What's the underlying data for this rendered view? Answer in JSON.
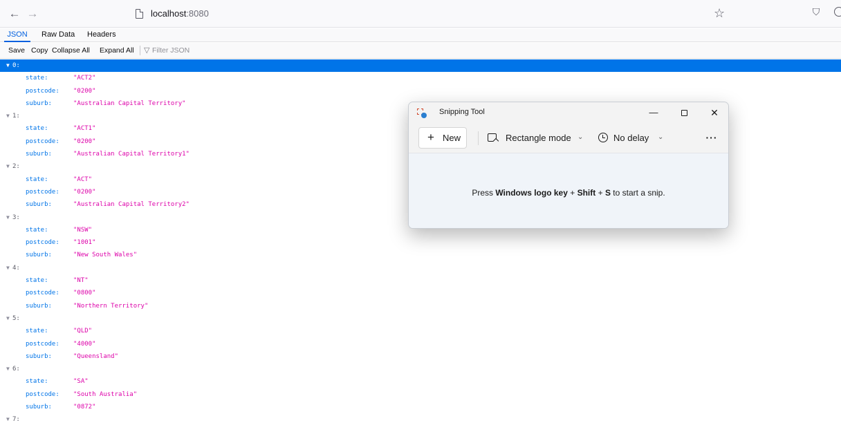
{
  "browser": {
    "back_icon": "←",
    "forward_icon": "→",
    "url_host": "localhost",
    "url_port": ":8080",
    "bookmark_icon": "☆",
    "pocket_icon": "⛉"
  },
  "viewer": {
    "tabs": [
      {
        "label": "JSON",
        "active": true
      },
      {
        "label": "Raw Data",
        "active": false
      },
      {
        "label": "Headers",
        "active": false
      }
    ],
    "toolbar": {
      "save": "Save",
      "copy": "Copy",
      "collapse_all": "Collapse All",
      "expand_all": "Expand All",
      "filter_placeholder": "Filter JSON"
    },
    "items": [
      {
        "index": "0:",
        "fields": [
          [
            "state:",
            "\"ACT2\""
          ],
          [
            "postcode:",
            "\"0200\""
          ],
          [
            "suburb:",
            "\"Australian Capital Territory\""
          ]
        ]
      },
      {
        "index": "1:",
        "fields": [
          [
            "state:",
            "\"ACT1\""
          ],
          [
            "postcode:",
            "\"0200\""
          ],
          [
            "suburb:",
            "\"Australian Capital Territory1\""
          ]
        ]
      },
      {
        "index": "2:",
        "fields": [
          [
            "state:",
            "\"ACT\""
          ],
          [
            "postcode:",
            "\"0200\""
          ],
          [
            "suburb:",
            "\"Australian Capital Territory2\""
          ]
        ]
      },
      {
        "index": "3:",
        "fields": [
          [
            "state:",
            "\"NSW\""
          ],
          [
            "postcode:",
            "\"1001\""
          ],
          [
            "suburb:",
            "\"New South Wales\""
          ]
        ]
      },
      {
        "index": "4:",
        "fields": [
          [
            "state:",
            "\"NT\""
          ],
          [
            "postcode:",
            "\"0800\""
          ],
          [
            "suburb:",
            "\"Northern Territory\""
          ]
        ]
      },
      {
        "index": "5:",
        "fields": [
          [
            "state:",
            "\"QLD\""
          ],
          [
            "postcode:",
            "\"4000\""
          ],
          [
            "suburb:",
            "\"Queensland\""
          ]
        ]
      },
      {
        "index": "6:",
        "fields": [
          [
            "state:",
            "\"SA\""
          ],
          [
            "postcode:",
            "\"South Australia\""
          ],
          [
            "suburb:",
            "\"0872\""
          ]
        ]
      },
      {
        "index": "7:",
        "fields": []
      }
    ],
    "selected_index": 0
  },
  "snipping_tool": {
    "title": "Snipping Tool",
    "minimize_icon": "—",
    "close_icon": "✕",
    "new_icon": "+",
    "new_label": "New",
    "mode_label": "Rectangle mode",
    "chevron": "⌄",
    "delay_label": "No delay",
    "more_icon": "···",
    "hint_prefix": "Press ",
    "hint_key1": "Windows logo key",
    "hint_plus1": " + ",
    "hint_key2": "Shift",
    "hint_plus2": " + ",
    "hint_key3": "S",
    "hint_suffix": " to start a snip."
  }
}
